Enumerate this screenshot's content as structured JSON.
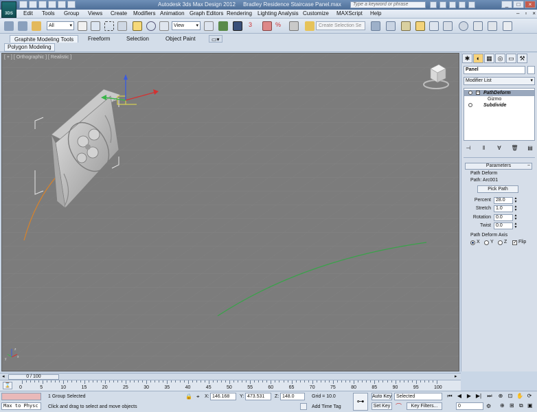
{
  "window": {
    "title": "Autodesk 3ds Max Design 2012",
    "file": "Bradley Residence Staircase Panel.max",
    "logo_label": "3DS",
    "search_placeholder": "Type a keyword or phrase"
  },
  "menu": [
    "Edit",
    "Tools",
    "Group",
    "Views",
    "Create",
    "Modifiers",
    "Animation",
    "Graph Editors",
    "Rendering",
    "Lighting Analysis",
    "Customize",
    "MAXScript",
    "Help"
  ],
  "toolbar": {
    "selection_filter": "All",
    "ref_coord": "View",
    "named_selection_placeholder": "Create Selection Se",
    "snap_angle_label": "3",
    "percent_snap_label": "%"
  },
  "ribbon": {
    "tabs": [
      "Graphite Modeling Tools",
      "Freeform",
      "Selection",
      "Object Paint"
    ],
    "subtab": "Polygon Modeling"
  },
  "viewport": {
    "label": "[ + ] [ Orthographic ] [ Realistic ]",
    "background": "#7c7c7c"
  },
  "command_panel": {
    "object_name": "Panel",
    "modifier_list": "Modifier List",
    "stack": [
      {
        "label": "PathDeform",
        "selected": true,
        "expandable": true
      },
      {
        "label": "Gizmo",
        "sub": true
      },
      {
        "label": "Subdivide",
        "selected": false
      }
    ],
    "parameters": {
      "header": "Parameters",
      "section": "Path Deform",
      "path_label": "Path: Arc001",
      "pick_path": "Pick Path",
      "percent_label": "Percent",
      "percent": "28.0",
      "stretch_label": "Stretch",
      "stretch": "1.0",
      "rotation_label": "Rotation",
      "rotation": "0.0",
      "twist_label": "Twist",
      "twist": "0.0",
      "axis_label": "Path Deform Axis",
      "axis_x": "X",
      "axis_y": "Y",
      "axis_z": "Z",
      "flip": "Flip",
      "selected_axis": "X",
      "flip_checked": true
    }
  },
  "timeline": {
    "frame": "0 / 100",
    "ticks": [
      "0",
      "5",
      "10",
      "15",
      "20",
      "25",
      "30",
      "35",
      "40",
      "45",
      "50",
      "55",
      "60",
      "65",
      "70",
      "75",
      "80",
      "85",
      "90",
      "95",
      "100"
    ]
  },
  "status": {
    "maxscript_prompt": "Max to Physc",
    "selection_info": "1 Group Selected",
    "prompt": "Click and drag to select and move objects",
    "x_label": "X:",
    "x": "146.168",
    "y_label": "Y:",
    "y": "473.531",
    "z_label": "Z:",
    "z": "148.0",
    "grid": "Grid = 10.0",
    "add_time_tag": "Add Time Tag",
    "auto_key": "Auto Key",
    "set_key": "Set Key",
    "key_mode": "Selected",
    "key_filters": "Key Filters...",
    "frame_field": "0"
  },
  "colors": {
    "arc_green": "#3aa24a",
    "arc_orange": "#d9832a",
    "gizmo_yellow": "#e8e04a"
  }
}
